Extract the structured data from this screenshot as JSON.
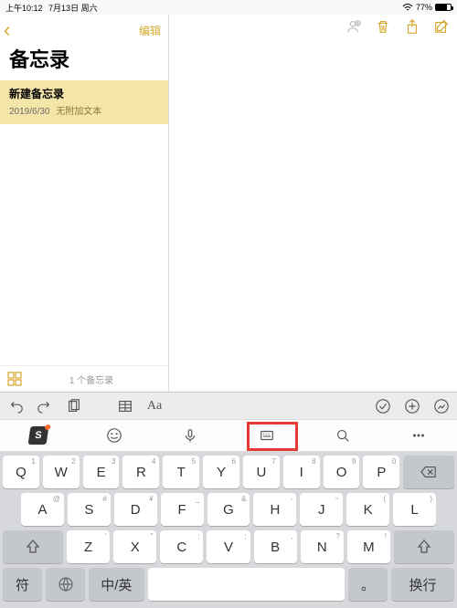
{
  "status": {
    "time": "上午10:12",
    "date": "7月13日 周六",
    "battery": "77%"
  },
  "sidebar": {
    "edit": "编辑",
    "title": "备忘录",
    "item": {
      "title": "新建备忘录",
      "date": "2019/6/30",
      "sub": "无附加文本"
    },
    "count": "1 个备忘录"
  },
  "accessory": {
    "aa": "Aa"
  },
  "kbToolbar": {
    "s_label": "S"
  },
  "keys": {
    "r1": [
      {
        "l": "Q",
        "n": "1"
      },
      {
        "l": "W",
        "n": "2"
      },
      {
        "l": "E",
        "n": "3"
      },
      {
        "l": "R",
        "n": "4"
      },
      {
        "l": "T",
        "n": "5"
      },
      {
        "l": "Y",
        "n": "6"
      },
      {
        "l": "U",
        "n": "7"
      },
      {
        "l": "I",
        "n": "8"
      },
      {
        "l": "O",
        "n": "9"
      },
      {
        "l": "P",
        "n": "0"
      }
    ],
    "r2": [
      {
        "l": "A",
        "n": "@"
      },
      {
        "l": "S",
        "n": "#"
      },
      {
        "l": "D",
        "n": "¥"
      },
      {
        "l": "F",
        "n": "_"
      },
      {
        "l": "G",
        "n": "&"
      },
      {
        "l": "H",
        "n": "-"
      },
      {
        "l": "J",
        "n": "~"
      },
      {
        "l": "K",
        "n": "("
      },
      {
        "l": "L",
        "n": ")"
      }
    ],
    "r3": [
      {
        "l": "Z",
        "n": "'"
      },
      {
        "l": "X",
        "n": "\""
      },
      {
        "l": "C",
        "n": ":"
      },
      {
        "l": "V",
        "n": ";"
      },
      {
        "l": "B",
        "n": ","
      },
      {
        "l": "N",
        "n": "?"
      },
      {
        "l": "M",
        "n": "!"
      }
    ],
    "bottom": {
      "sym": "符",
      "lang": "中/英",
      "space": "",
      "punct": "。",
      "enter": "换行"
    }
  }
}
